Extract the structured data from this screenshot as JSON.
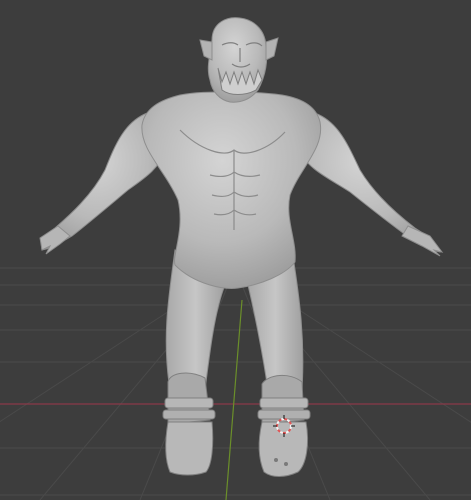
{
  "viewport": {
    "background": "#3d3d3d",
    "grid_color": "#4a4a4a",
    "x_axis_color": "#8a3a48",
    "y_axis_color": "#6b8f2a"
  },
  "model": {
    "skin_base": "#bdbdbd",
    "skin_shadow": "#8f8f8f",
    "skin_highlight": "#d6d6d6"
  },
  "cursor_3d": {
    "ring_color_a": "#e05555",
    "ring_color_b": "#f2f2f2"
  }
}
